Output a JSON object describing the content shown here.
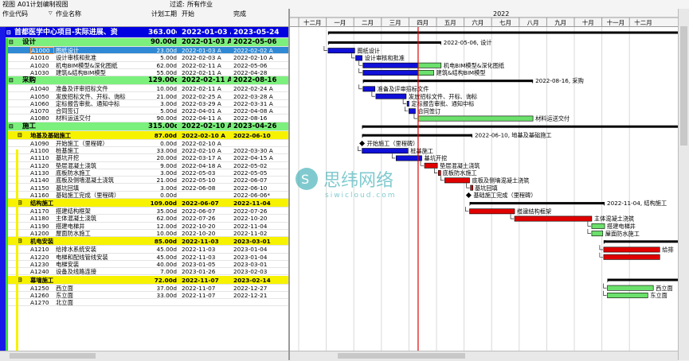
{
  "toolbar": {
    "view_label": "视图",
    "view_name": "A01计划编制视图",
    "filter_label": "过滤:",
    "filter_value": "所有作业"
  },
  "columns": {
    "id": "作业代码",
    "name": "作业名称",
    "dur": "计划工期",
    "start": "开始",
    "fin": "完成"
  },
  "timeline": {
    "year": "2022",
    "months": [
      "十二月",
      "一月",
      "二月",
      "三月",
      "四月",
      "五月",
      "六月",
      "七月",
      "八月",
      "九月",
      "十月",
      "十一月",
      "十二月"
    ]
  },
  "watermark": {
    "cn": "思纬网络",
    "en": "siwicloud.com"
  },
  "rows": [
    {
      "t": "project",
      "name": "首都医学中心项目-实际进展、资",
      "dur": "363.00d",
      "start": "2022-01-03 A",
      "fin": "2023-05-24"
    },
    {
      "t": "wbs1",
      "name": "设计",
      "dur": "90.00d",
      "start": "2022-01-03 A",
      "fin": "2022-05-06"
    },
    {
      "t": "sel",
      "id": "A1000",
      "name": "图纸设计",
      "dur": "23.00d",
      "start": "2022-01-03 A",
      "fin": "2022-02-02 A"
    },
    {
      "t": "task",
      "id": "A1010",
      "name": "设计审核和批准",
      "dur": "5.00d",
      "start": "2022-02-03 A",
      "fin": "2022-02-10 A"
    },
    {
      "t": "task",
      "id": "A1020",
      "name": "机电BIM模型&深化图纸",
      "dur": "62.00d",
      "start": "2022-02-11 A",
      "fin": "2022-05-06"
    },
    {
      "t": "task",
      "id": "A1030",
      "name": "建筑&结构BIM模型",
      "dur": "55.00d",
      "start": "2022-02-11 A",
      "fin": "2022-04-28"
    },
    {
      "t": "wbs1",
      "name": "采购",
      "dur": "129.00d",
      "start": "2022-02-11 A",
      "fin": "2022-08-16"
    },
    {
      "t": "task",
      "id": "A1040",
      "name": "准备及评审招标文件",
      "dur": "10.00d",
      "start": "2022-02-11 A",
      "fin": "2022-02-24 A"
    },
    {
      "t": "task",
      "id": "A1050",
      "name": "发放招标文件、开标、询标",
      "dur": "21.00d",
      "start": "2022-02-25 A",
      "fin": "2022-03-28 A"
    },
    {
      "t": "task",
      "id": "A1060",
      "name": "定标报告审批、通知中标",
      "dur": "3.00d",
      "start": "2022-03-29 A",
      "fin": "2022-03-31 A"
    },
    {
      "t": "task",
      "id": "A1070",
      "name": "合同签订",
      "dur": "5.00d",
      "start": "2022-04-01 A",
      "fin": "2022-04-08 A"
    },
    {
      "t": "task",
      "id": "A1080",
      "name": "材料运送交付",
      "dur": "90.00d",
      "start": "2022-04-11 A",
      "fin": "2022-08-16"
    },
    {
      "t": "wbs1",
      "name": "施工",
      "dur": "315.00d",
      "start": "2022-02-10 A",
      "fin": "2023-04-26"
    },
    {
      "t": "wbs2",
      "name": "地基及基础施工",
      "dur": "87.00d",
      "start": "2022-02-10 A",
      "fin": "2022-06-10"
    },
    {
      "t": "task",
      "id": "A1090",
      "name": "开始施工（里程碑）",
      "dur": "0.00d",
      "start": "2022-02-10 A",
      "fin": ""
    },
    {
      "t": "task",
      "id": "A1100",
      "name": "桩基施工",
      "dur": "33.00d",
      "start": "2022-02-10 A",
      "fin": "2022-03-30 A"
    },
    {
      "t": "task",
      "id": "A1110",
      "name": "基坑开挖",
      "dur": "20.00d",
      "start": "2022-03-17 A",
      "fin": "2022-04-15 A"
    },
    {
      "t": "task",
      "id": "A1120",
      "name": "垫层混凝土浇筑",
      "dur": "9.00d",
      "start": "2022-04-18 A",
      "fin": "2022-05-02"
    },
    {
      "t": "task",
      "id": "A1130",
      "name": "底板防水施工",
      "dur": "3.00d",
      "start": "2022-05-03",
      "fin": "2022-05-05"
    },
    {
      "t": "task",
      "id": "A1140",
      "name": "底板及侧墙混凝土浇筑",
      "dur": "21.00d",
      "start": "2022-05-10",
      "fin": "2022-06-07"
    },
    {
      "t": "task",
      "id": "A1150",
      "name": "基坑回填",
      "dur": "3.00d",
      "start": "2022-06-08",
      "fin": "2022-06-10"
    },
    {
      "t": "task",
      "id": "A1160",
      "name": "基础施工完成（里程碑）",
      "dur": "0.00d",
      "start": "",
      "fin": "2022-06-06*"
    },
    {
      "t": "wbs2",
      "name": "结构施工",
      "dur": "109.00d",
      "start": "2022-06-07",
      "fin": "2022-11-04"
    },
    {
      "t": "task",
      "id": "A1170",
      "name": "搭建结构框架",
      "dur": "35.00d",
      "start": "2022-06-07",
      "fin": "2022-07-26"
    },
    {
      "t": "task",
      "id": "A1180",
      "name": "主体混凝土浇筑",
      "dur": "62.00d",
      "start": "2022-07-26",
      "fin": "2022-10-20"
    },
    {
      "t": "task",
      "id": "A1190",
      "name": "搭建电梯井",
      "dur": "12.00d",
      "start": "2022-10-20",
      "fin": "2022-11-04"
    },
    {
      "t": "task",
      "id": "A1200",
      "name": "屋面防水施工",
      "dur": "10.00d",
      "start": "2022-10-20",
      "fin": "2022-11-02"
    },
    {
      "t": "wbs2",
      "name": "机电安装",
      "dur": "85.00d",
      "start": "2022-11-03",
      "fin": "2023-03-01"
    },
    {
      "t": "task",
      "id": "A1210",
      "name": "给排水系统安装",
      "dur": "45.00d",
      "start": "2022-11-03",
      "fin": "2023-01-04"
    },
    {
      "t": "task",
      "id": "A1220",
      "name": "电梯和配线管线安装",
      "dur": "45.00d",
      "start": "2022-11-03",
      "fin": "2023-01-04"
    },
    {
      "t": "task",
      "id": "A1230",
      "name": "电梯安装",
      "dur": "40.00d",
      "start": "2023-01-05",
      "fin": "2023-03-01"
    },
    {
      "t": "task",
      "id": "A1240",
      "name": "设备及线路连接",
      "dur": "7.00d",
      "start": "2023-01-26",
      "fin": "2023-02-03"
    },
    {
      "t": "wbs2",
      "name": "幕墙施工",
      "dur": "72.00d",
      "start": "2022-11-07",
      "fin": "2023-02-14"
    },
    {
      "t": "task",
      "id": "A1250",
      "name": "西立面",
      "dur": "37.00d",
      "start": "2022-11-07",
      "fin": "2022-12-27"
    },
    {
      "t": "task",
      "id": "A1260",
      "name": "东立面",
      "dur": "33.00d",
      "start": "2022-11-07",
      "fin": "2022-12-21"
    },
    {
      "t": "task",
      "id": "A1270",
      "name": "北立面",
      "dur": "",
      "start": "",
      "fin": ""
    }
  ],
  "bar_labels": {
    "wbs_design": "2022-05-06, 设计",
    "wbs_purchase": "2022-08-16, 采购",
    "wbs_foundation": "2022-06-10, 地基及基础施工",
    "wbs_structure": "2022-11-04, 结构施工",
    "project_end": "2023-05-24"
  },
  "colors": {
    "project": "#0000e0",
    "wbs1": "#7cf07c",
    "wbs2": "#f6f200",
    "selected": "#2f89d4",
    "bar_actual": "#1010d8",
    "bar_remaining": "#6ce06c",
    "bar_critical": "#e00000",
    "data_date": "#e00000",
    "summary": "#000000"
  },
  "gantt": {
    "bars": [
      {
        "row": 2,
        "kind": "actual",
        "s": "2022-01-03",
        "e": "2022-02-02",
        "label": "图纸设计"
      },
      {
        "row": 3,
        "kind": "actual",
        "s": "2022-02-03",
        "e": "2022-02-10",
        "label": "设计审核和批准"
      },
      {
        "row": 4,
        "kind": "mixed",
        "s": "2022-02-11",
        "e": "2022-05-06",
        "label": "机电BIM模型&深化图纸"
      },
      {
        "row": 5,
        "kind": "mixed",
        "s": "2022-02-11",
        "e": "2022-04-28",
        "label": "建筑&结构BIM模型"
      },
      {
        "row": 7,
        "kind": "actual",
        "s": "2022-02-11",
        "e": "2022-02-24",
        "label": "准备及评审招标文件"
      },
      {
        "row": 8,
        "kind": "actual",
        "s": "2022-02-25",
        "e": "2022-03-28",
        "label": "发放招标文件、开标、询标"
      },
      {
        "row": 9,
        "kind": "actual",
        "s": "2022-03-29",
        "e": "2022-03-31",
        "label": "定标报告审批、通知中标"
      },
      {
        "row": 10,
        "kind": "actual",
        "s": "2022-04-01",
        "e": "2022-04-08",
        "label": "合同签订"
      },
      {
        "row": 11,
        "kind": "remaining",
        "s": "2022-04-11",
        "e": "2022-08-16",
        "label": "材料运送交付"
      },
      {
        "row": 15,
        "kind": "actual",
        "s": "2022-02-10",
        "e": "2022-03-30",
        "label": "桩基施工"
      },
      {
        "row": 16,
        "kind": "actual",
        "s": "2022-03-17",
        "e": "2022-04-15",
        "label": "基坑开挖"
      },
      {
        "row": 17,
        "kind": "critical",
        "s": "2022-04-18",
        "e": "2022-05-02",
        "label": "垫层混凝土浇筑"
      },
      {
        "row": 18,
        "kind": "critical",
        "s": "2022-05-03",
        "e": "2022-05-05",
        "label": "底板防水施工"
      },
      {
        "row": 19,
        "kind": "critical",
        "s": "2022-05-10",
        "e": "2022-06-07",
        "label": "底板及侧墙混凝土浇筑"
      },
      {
        "row": 20,
        "kind": "critical",
        "s": "2022-06-08",
        "e": "2022-06-10",
        "label": "基坑回填"
      },
      {
        "row": 23,
        "kind": "critical",
        "s": "2022-06-07",
        "e": "2022-07-26",
        "label": "搭建结构框架"
      },
      {
        "row": 24,
        "kind": "critical",
        "s": "2022-07-26",
        "e": "2022-10-20",
        "label": "主体混凝土浇筑"
      },
      {
        "row": 25,
        "kind": "remaining",
        "s": "2022-10-20",
        "e": "2022-11-04",
        "label": "搭建电梯井"
      },
      {
        "row": 26,
        "kind": "remaining",
        "s": "2022-10-20",
        "e": "2022-11-02",
        "label": "屋面防水施工"
      },
      {
        "row": 28,
        "kind": "critical",
        "s": "2022-11-03",
        "e": "2023-01-04",
        "label": "给排"
      },
      {
        "row": 29,
        "kind": "critical",
        "s": "2022-11-03",
        "e": "2023-01-04",
        "label": ""
      },
      {
        "row": 33,
        "kind": "remaining",
        "s": "2022-11-07",
        "e": "2022-12-27",
        "label": "西立面"
      },
      {
        "row": 34,
        "kind": "remaining",
        "s": "2022-11-07",
        "e": "2022-12-21",
        "label": "东立面"
      }
    ],
    "summaries": [
      {
        "row": 0,
        "s": "2022-01-03",
        "e": "2023-05-24",
        "label": ""
      },
      {
        "row": 1,
        "s": "2022-01-03",
        "e": "2022-05-06",
        "label": "2022-05-06, 设计"
      },
      {
        "row": 6,
        "s": "2022-02-11",
        "e": "2022-08-16",
        "label": "2022-08-16, 采购"
      },
      {
        "row": 12,
        "s": "2022-02-10",
        "e": "2023-04-26",
        "label": ""
      },
      {
        "row": 13,
        "s": "2022-02-10",
        "e": "2022-06-10",
        "label": "2022-06-10, 地基及基础施工"
      },
      {
        "row": 22,
        "s": "2022-06-07",
        "e": "2022-11-04",
        "label": "2022-11-04, 结构施工"
      },
      {
        "row": 27,
        "s": "2022-11-03",
        "e": "2023-03-01",
        "label": ""
      },
      {
        "row": 32,
        "s": "2022-11-07",
        "e": "2023-02-14",
        "label": ""
      }
    ],
    "milestones": [
      {
        "row": 14,
        "d": "2022-02-10",
        "label": "开始施工（里程碑）"
      },
      {
        "row": 21,
        "d": "2022-06-06",
        "label": "基础施工完成（里程碑）"
      }
    ],
    "data_date": "2022-04-11"
  }
}
